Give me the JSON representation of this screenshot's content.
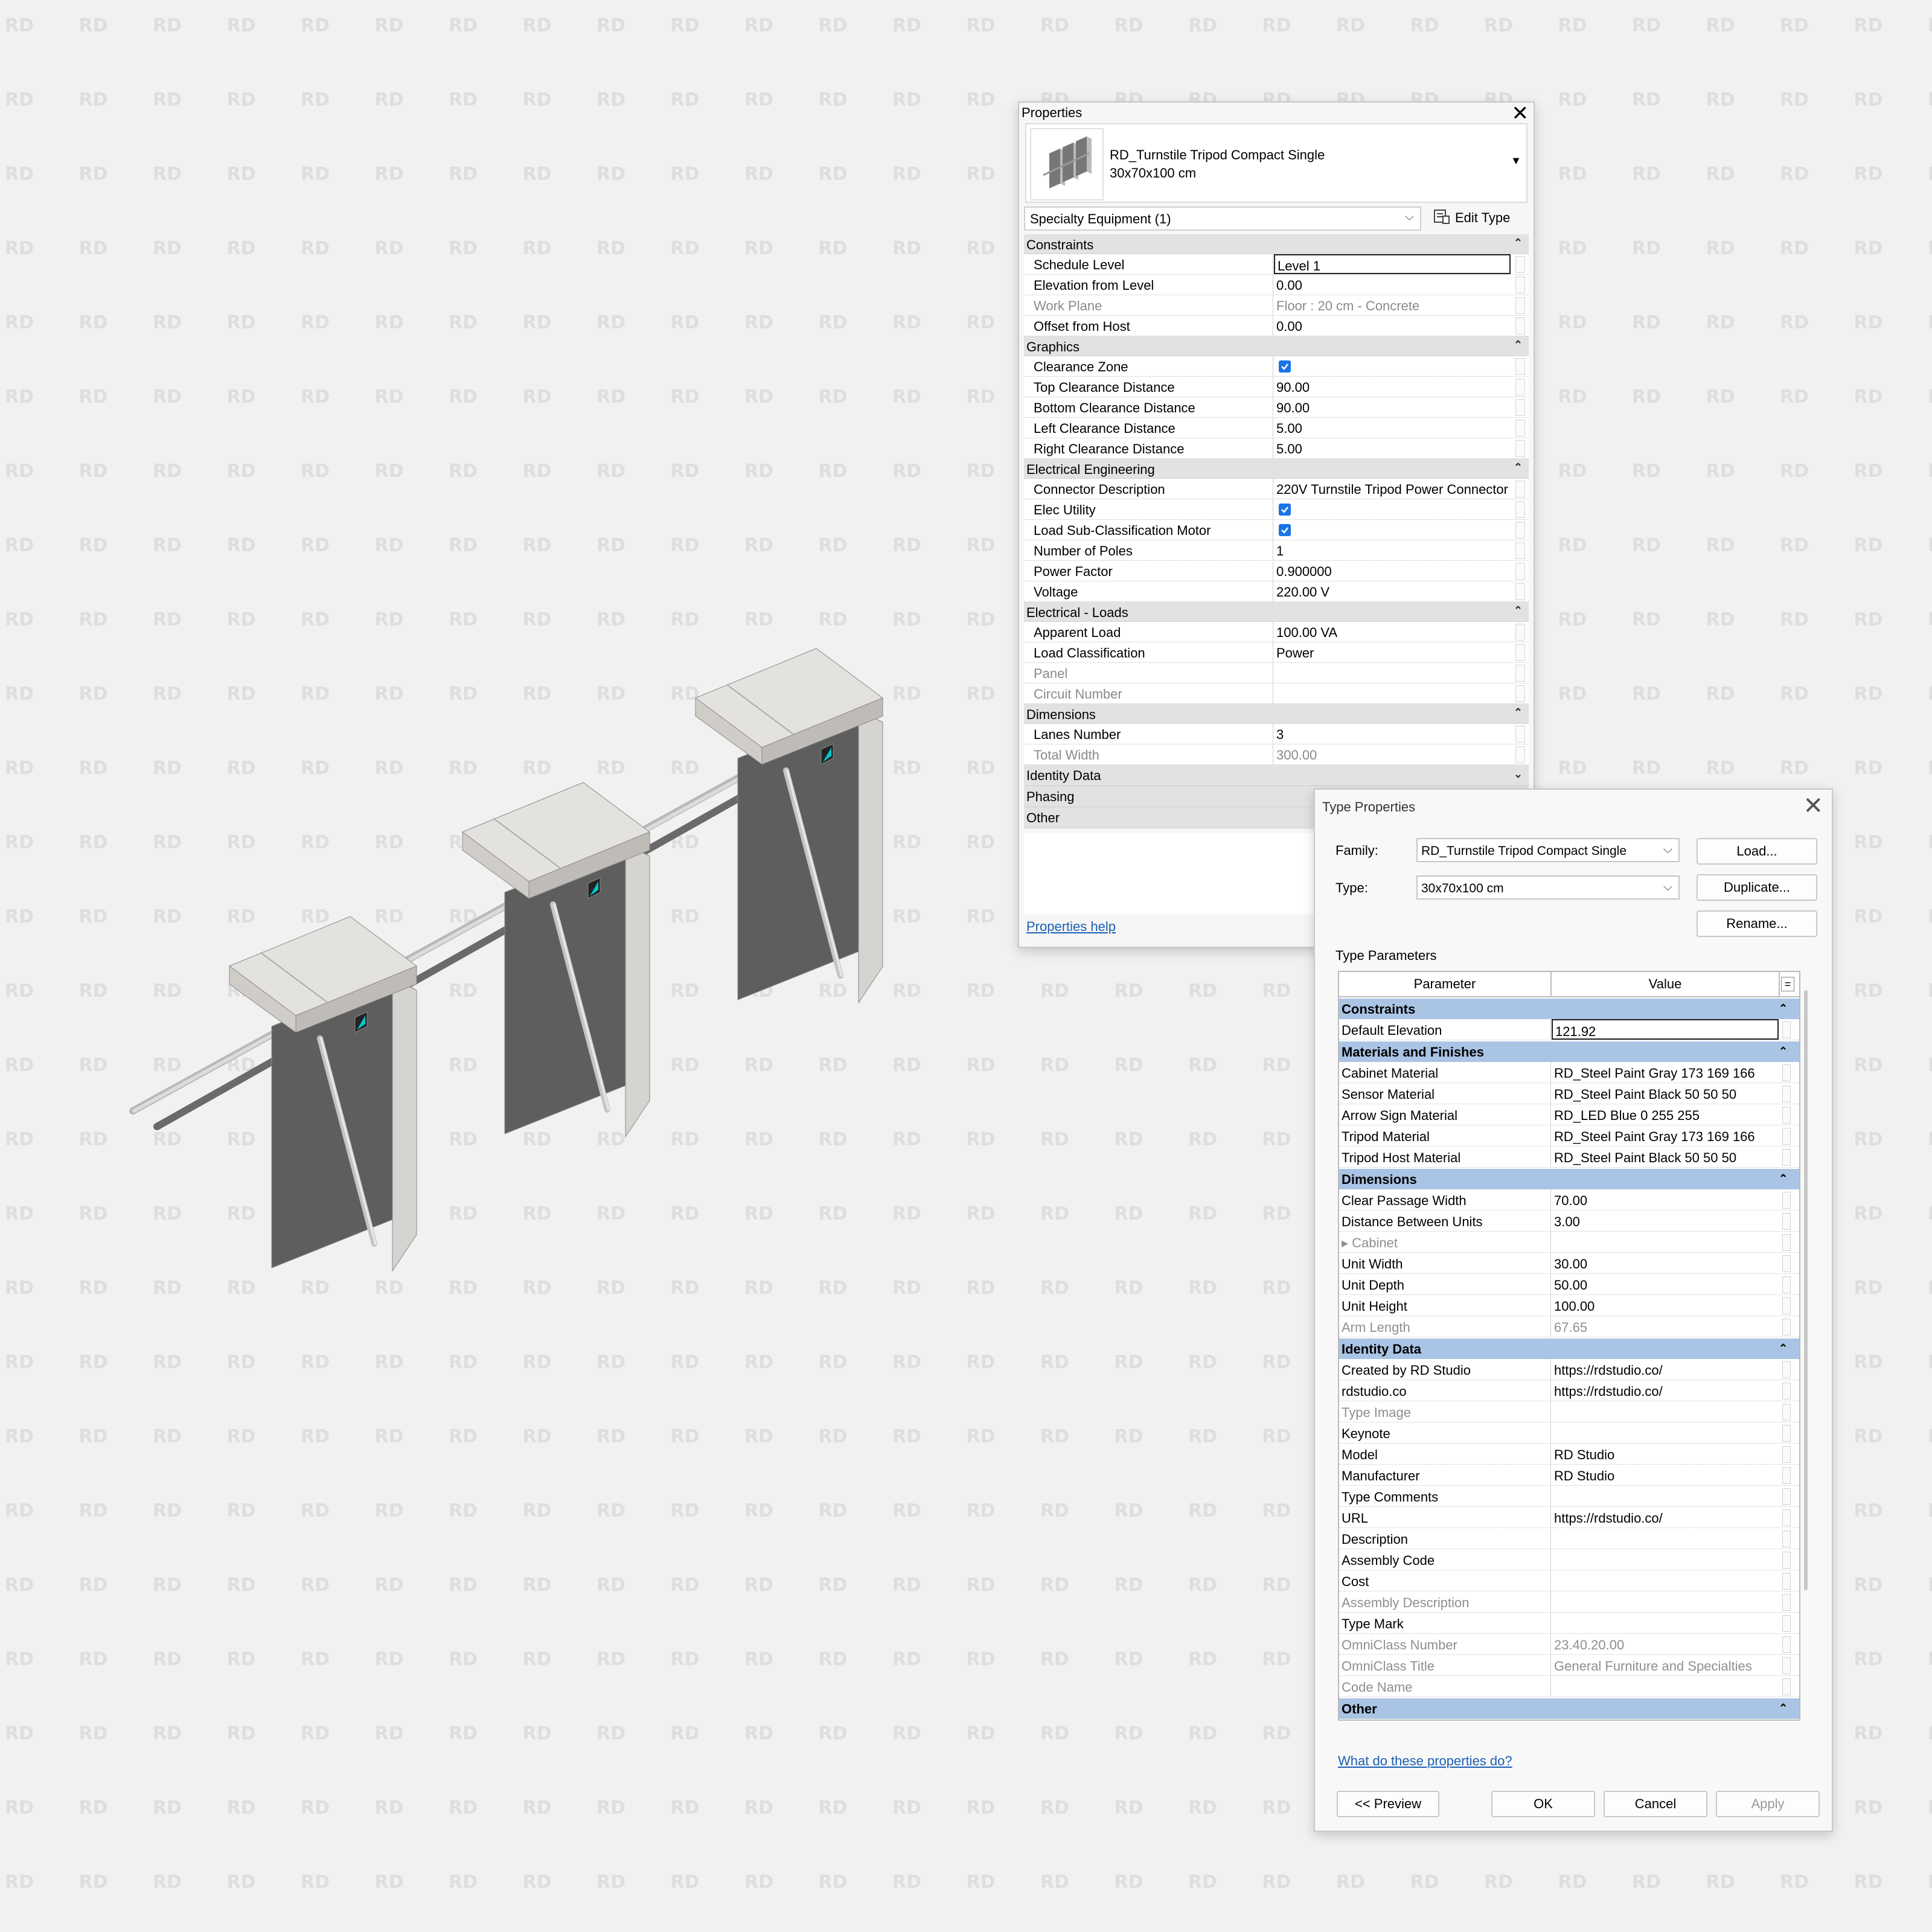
{
  "watermark_text": "RD",
  "properties": {
    "title": "Properties",
    "close": "✕",
    "type_name": "RD_Turnstile Tripod Compact Single",
    "type_size": "30x70x100 cm",
    "instance_filter": "Specialty Equipment (1)",
    "edit_type": "Edit Type",
    "help": "Properties help",
    "groups": [
      {
        "label": "Constraints",
        "rows": [
          {
            "name": "Schedule Level",
            "value": "Level 1",
            "boxed": true
          },
          {
            "name": "Elevation from Level",
            "value": "0.00"
          },
          {
            "name": "Work Plane",
            "value": "Floor : 20 cm - Concrete",
            "disabled": true
          },
          {
            "name": "Offset from Host",
            "value": "0.00"
          }
        ]
      },
      {
        "label": "Graphics",
        "rows": [
          {
            "name": "Clearance Zone",
            "checked": true
          },
          {
            "name": "Top Clearance Distance",
            "value": "90.00"
          },
          {
            "name": "Bottom Clearance Distance",
            "value": "90.00"
          },
          {
            "name": "Left Clearance Distance",
            "value": "5.00"
          },
          {
            "name": "Right Clearance Distance",
            "value": "5.00"
          }
        ]
      },
      {
        "label": "Electrical Engineering",
        "rows": [
          {
            "name": "Connector Description",
            "value": "220V Turnstile Tripod Power Connector"
          },
          {
            "name": "Elec Utility",
            "checked": true
          },
          {
            "name": "Load Sub-Classification Motor",
            "checked": true
          },
          {
            "name": "Number of Poles",
            "value": "1"
          },
          {
            "name": "Power Factor",
            "value": "0.900000"
          },
          {
            "name": "Voltage",
            "value": "220.00 V"
          }
        ]
      },
      {
        "label": "Electrical - Loads",
        "rows": [
          {
            "name": "Apparent Load",
            "value": "100.00 VA"
          },
          {
            "name": "Load Classification",
            "value": "Power"
          },
          {
            "name": "Panel",
            "value": "",
            "disabled": true
          },
          {
            "name": "Circuit Number",
            "value": "",
            "disabled": true
          }
        ]
      },
      {
        "label": "Dimensions",
        "rows": [
          {
            "name": "Lanes Number",
            "value": "3"
          },
          {
            "name": "Total Width",
            "value": "300.00",
            "disabled": true
          }
        ]
      }
    ],
    "collapsed_groups": [
      "Identity Data",
      "Phasing",
      "Other"
    ]
  },
  "type_properties": {
    "title": "Type Properties",
    "close": "✕",
    "family_label": "Family:",
    "family_value": "RD_Turnstile Tripod Compact Single",
    "type_label": "Type:",
    "type_value": "30x70x100 cm",
    "load": "Load...",
    "duplicate": "Duplicate...",
    "rename": "Rename...",
    "params_label": "Type Parameters",
    "col_param": "Parameter",
    "col_value": "Value",
    "col_eq": "=",
    "groups": [
      {
        "label": "Constraints",
        "rows": [
          {
            "name": "Default Elevation",
            "value": "121.92",
            "boxed": true
          }
        ]
      },
      {
        "label": "Materials and Finishes",
        "rows": [
          {
            "name": "Cabinet Material",
            "value": "RD_Steel Paint Gray 173 169 166"
          },
          {
            "name": "Sensor Material",
            "value": "RD_Steel Paint Black 50 50 50"
          },
          {
            "name": "Arrow Sign Material",
            "value": "RD_LED Blue 0 255 255"
          },
          {
            "name": "Tripod Material",
            "value": "RD_Steel Paint Gray 173 169 166"
          },
          {
            "name": "Tripod Host Material",
            "value": "RD_Steel Paint Black 50 50 50"
          }
        ]
      },
      {
        "label": "Dimensions",
        "rows": [
          {
            "name": "Clear Passage Width",
            "value": "70.00"
          },
          {
            "name": "Distance Between Units",
            "value": "3.00"
          },
          {
            "name": "▸ Cabinet",
            "value": "",
            "disabled": true
          },
          {
            "name": "Unit Width",
            "value": "30.00"
          },
          {
            "name": "Unit Depth",
            "value": "50.00"
          },
          {
            "name": "Unit Height",
            "value": "100.00"
          },
          {
            "name": "Arm Length",
            "value": "67.65",
            "disabled": true
          }
        ]
      },
      {
        "label": "Identity Data",
        "rows": [
          {
            "name": "Created by RD Studio",
            "value": "https://rdstudio.co/"
          },
          {
            "name": "rdstudio.co",
            "value": "https://rdstudio.co/"
          },
          {
            "name": "Type Image",
            "value": "",
            "disabled": true
          },
          {
            "name": "Keynote",
            "value": ""
          },
          {
            "name": "Model",
            "value": "RD Studio"
          },
          {
            "name": "Manufacturer",
            "value": "RD Studio"
          },
          {
            "name": "Type Comments",
            "value": ""
          },
          {
            "name": "URL",
            "value": "https://rdstudio.co/"
          },
          {
            "name": "Description",
            "value": ""
          },
          {
            "name": "Assembly Code",
            "value": ""
          },
          {
            "name": "Cost",
            "value": ""
          },
          {
            "name": "Assembly Description",
            "value": "",
            "disabled": true
          },
          {
            "name": "Type Mark",
            "value": ""
          },
          {
            "name": "OmniClass Number",
            "value": "23.40.20.00",
            "disabled": true
          },
          {
            "name": "OmniClass Title",
            "value": "General Furniture and Specialties",
            "disabled": true
          },
          {
            "name": "Code Name",
            "value": "",
            "disabled": true
          }
        ]
      },
      {
        "label": "Other",
        "rows": []
      }
    ],
    "help": "What do these properties do?",
    "preview": "<< Preview",
    "ok": "OK",
    "cancel": "Cancel",
    "apply": "Apply"
  },
  "colors": {
    "group_header_blue": "#a9c4e4",
    "checkbox_blue": "#1a73e8",
    "link_blue": "#1a5fb4",
    "arrow_sign": "#00c8c8"
  }
}
